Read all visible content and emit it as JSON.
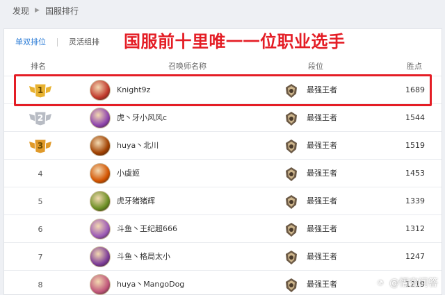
{
  "breadcrumb": {
    "home": "发现",
    "current": "国服排行"
  },
  "tabs": [
    {
      "label": "单双排位",
      "active": true
    },
    {
      "label": "灵活组排",
      "active": false
    }
  ],
  "banner": "国服前十里唯一一位职业选手",
  "columns": {
    "rank": "排名",
    "summoner": "召唤师名称",
    "tier": "段位",
    "lp": "胜点"
  },
  "rows": [
    {
      "rank": "1",
      "badge": "gold",
      "name": "Knight9z",
      "tier": "最强王者",
      "lp": "1689",
      "avatar_color": "#c0392b"
    },
    {
      "rank": "2",
      "badge": "silver",
      "name": "虎丶牙小风风c",
      "tier": "最强王者",
      "lp": "1544",
      "avatar_color": "#8e44ad"
    },
    {
      "rank": "3",
      "badge": "bronze",
      "name": "huya丶北川",
      "tier": "最强王者",
      "lp": "1519",
      "avatar_color": "#a04000"
    },
    {
      "rank": "4",
      "badge": "",
      "name": "小虞姬",
      "tier": "最强王者",
      "lp": "1453",
      "avatar_color": "#d35400"
    },
    {
      "rank": "5",
      "badge": "",
      "name": "虎牙猪猪辉",
      "tier": "最强王者",
      "lp": "1339",
      "avatar_color": "#6b8e23"
    },
    {
      "rank": "6",
      "badge": "",
      "name": "斗鱼丶王纪超666",
      "tier": "最强王者",
      "lp": "1312",
      "avatar_color": "#9b59b6"
    },
    {
      "rank": "7",
      "badge": "",
      "name": "斗鱼丶格局太小",
      "tier": "最强王者",
      "lp": "1247",
      "avatar_color": "#7d3c98"
    },
    {
      "rank": "8",
      "badge": "",
      "name": "huya丶MangoDog",
      "tier": "最强王者",
      "lp": "1219",
      "avatar_color": "#c0567a"
    }
  ],
  "watermark": {
    "text": "@悟空问答"
  },
  "colors": {
    "accent": "#2a7bd6",
    "highlight": "#e41d25",
    "gold": "#e8b230",
    "silver": "#b8bcc4",
    "bronze": "#e09a2a"
  }
}
